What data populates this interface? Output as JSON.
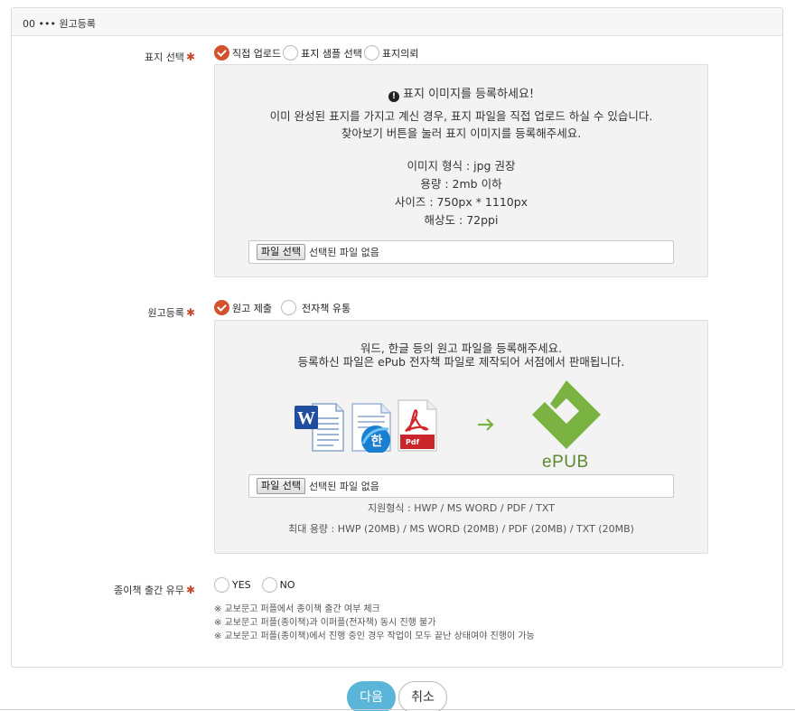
{
  "header": {
    "title": "00 ••• 원고등록"
  },
  "cover": {
    "label": "표지 선택",
    "required_mark": "✱",
    "options": [
      "직접 업로드",
      "표지 샘플 선택",
      "표지의뢰"
    ],
    "selected": "직접 업로드",
    "notice_title": "표지 이미지를 등록하세요!",
    "notice_line1": "이미 완성된 표지를 가지고 계신 경우, 표지 파일을 직접 업로드 하실 수 있습니다.",
    "notice_line2": "찾아보기 버튼을 눌러 표지 이미지를 등록해주세요.",
    "spec_format": "이미지 형식 : jpg 권장",
    "spec_size": "용량 : 2mb 이하",
    "spec_dims": "사이즈 : 750px * 1110px",
    "spec_resolution": "해상도 : 72ppi",
    "file_button": "파일 선택",
    "file_status": "선택된 파일 없음"
  },
  "manuscript": {
    "label": "원고등록",
    "required_mark": "✱",
    "options": [
      "원고 제출",
      "전자책 유통"
    ],
    "selected": "원고 제출",
    "desc_line1": "워드, 한글 등의 원고 파일을 등록해주세요.",
    "desc_line2": "등록하신 파일은 ePub 전자책 파일로 제작되어 서점에서 판매됩니다.",
    "icons": [
      "word-doc-icon",
      "hangul-doc-icon",
      "pdf-doc-icon",
      "arrow-right-icon",
      "epub-logo"
    ],
    "pdf_badge": "Pdf",
    "epub_text": "ePUB",
    "file_button": "파일 선택",
    "file_status": "선택된 파일 없음",
    "supported": "지원형식 : HWP / MS WORD / PDF / TXT",
    "max_size": "최대 용량 : HWP (20MB) / MS WORD (20MB) / PDF (20MB) / TXT (20MB)"
  },
  "paper": {
    "label": "종이책 출간 유무",
    "required_mark": "✱",
    "options": [
      "YES",
      "NO"
    ],
    "notes": [
      "※ 교보문고 퍼플에서 종이책 출간 여부 체크",
      "※ 교보문고 퍼플(종이책)과 이퍼플(전자책) 동시 진행 불가",
      "※ 교보문고 퍼플(종이책)에서 진행 중인 경우 작업이 모두 끝난 상태여야 진행이 가능"
    ]
  },
  "actions": {
    "next": "다음",
    "cancel": "취소"
  },
  "colors": {
    "accent": "#d2522b",
    "next_button": "#5bb5d9",
    "epub_green": "#7ab342"
  }
}
